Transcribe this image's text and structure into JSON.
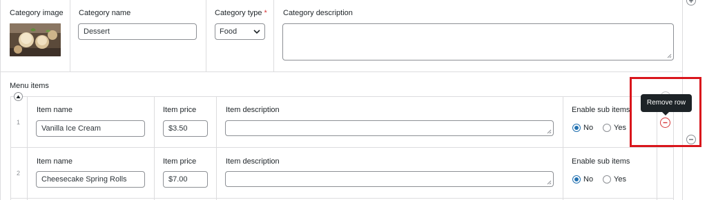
{
  "category": {
    "image_label": "Category image",
    "name_label": "Category name",
    "name_value": "Dessert",
    "type_label": "Category type",
    "type_required_mark": "*",
    "type_value": "Food",
    "description_label": "Category description",
    "description_value": ""
  },
  "menu": {
    "title": "Menu items",
    "rows": [
      {
        "index": "1",
        "item_name_label": "Item name",
        "item_name_value": "Vanilla Ice Cream",
        "price_label": "Item price",
        "price_value": "$3.50",
        "description_label": "Item description",
        "description_value": "",
        "sub_items_label": "Enable sub items",
        "option_no": "No",
        "option_yes": "Yes",
        "selected": "No"
      },
      {
        "index": "2",
        "item_name_label": "Item name",
        "item_name_value": "Cheesecake Spring Rolls",
        "price_label": "Item price",
        "price_value": "$7.00",
        "description_label": "Item description",
        "description_value": "",
        "sub_items_label": "Enable sub items",
        "option_no": "No",
        "option_yes": "Yes",
        "selected": "No"
      }
    ]
  },
  "tooltip": {
    "text": "Remove row"
  },
  "icons": {
    "plus": "plus-icon",
    "minus": "minus-icon",
    "collapse": "chevron-up-icon",
    "dropdown": "chevron-down-icon"
  },
  "colors": {
    "remove_accent": "#d63638",
    "highlight_box": "#d9151b",
    "tooltip_bg": "#1d2327",
    "radio_checked": "#2271b1"
  }
}
